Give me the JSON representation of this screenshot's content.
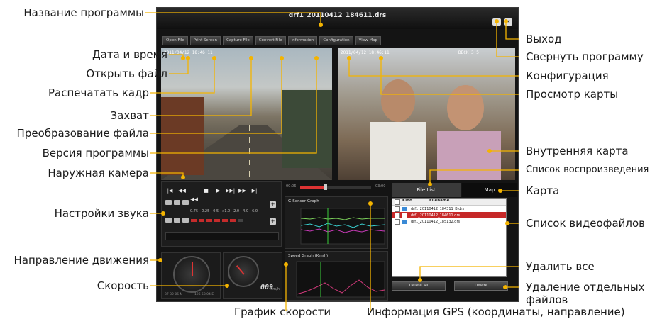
{
  "app": {
    "title": "drf1_20110412_184611.drs",
    "menu": [
      "Open File",
      "Print Screen",
      "Capture File",
      "Convert File",
      "Information",
      "Configuration",
      "View Map"
    ],
    "outside_stamp": "2011/04/12 18:46:11",
    "inside_stamp_left": "2011/04/12 18:46:11",
    "inside_stamp_right": "DECK 3.5",
    "seek": {
      "start": "00:06",
      "end": "03:00",
      "progress": 0.36
    },
    "volume_scale": [
      "0.75",
      "0.25",
      "0.5",
      "x1.0",
      "2.0",
      "4.0",
      "6.0"
    ],
    "gsensor_title": "G-Sensor Graph",
    "speed_title": "Speed Graph (Km/h)",
    "speed_value": "009",
    "speed_unit": "km/h",
    "gps_left": "37 32 06 N",
    "gps_right": "126 58 04 E",
    "tabs": {
      "files": "File List",
      "map": "Map"
    },
    "file_list": {
      "headers": [
        "Kind",
        "Filename"
      ],
      "rows": [
        {
          "name": "drf1_20110412_184311_B.drs",
          "selected": false
        },
        {
          "name": "drf1_20110412_184611.drs",
          "selected": true
        },
        {
          "name": "drf1_20110412_185132.drs",
          "selected": false
        }
      ]
    },
    "buttons": {
      "delete_all": "Delete All",
      "delete": "Delete"
    }
  },
  "annotations": {
    "left": [
      "Название программы",
      "Дата и время",
      "Открыть файл",
      "Распечатать кадр",
      "Захват",
      "Преобразование файла",
      "Версия программы",
      "Наружная камера",
      "Настройки звука",
      "Направление движения",
      "Скорость"
    ],
    "right": [
      "Выход",
      "Свернуть программу",
      "Конфигурация",
      "Просмотр карты",
      "Внутренняя карта",
      "Список воспроизведения",
      "Карта",
      "Список видеофайлов",
      "Удалить все",
      "Удаление отдельных файлов"
    ],
    "bottom": [
      "График скорости",
      "Информация GPS (координаты, направление)"
    ]
  },
  "colors": {
    "accent": "#f4b400",
    "selected_row": "#c62828",
    "window_bg": "#141414"
  }
}
